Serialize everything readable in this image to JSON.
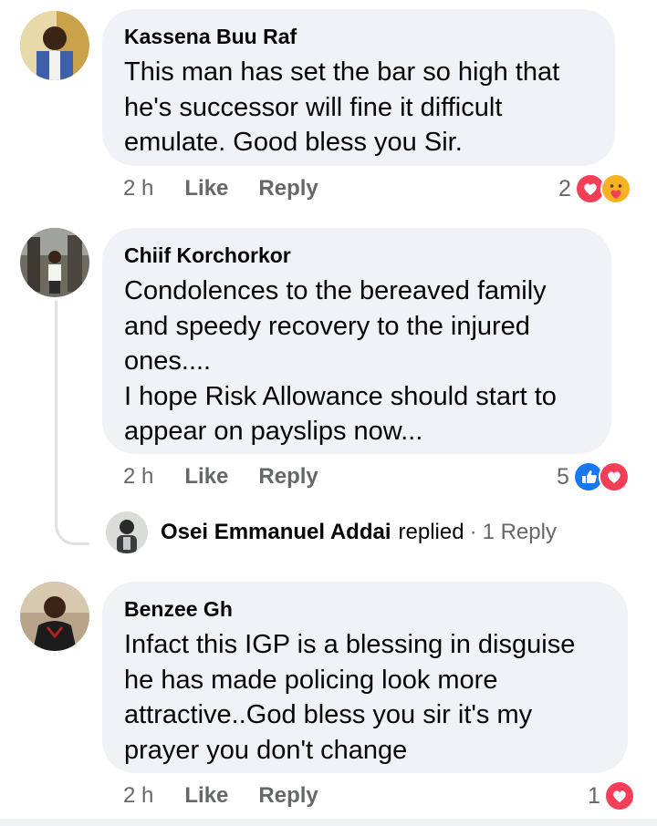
{
  "comments": [
    {
      "author": "Kassena Buu Raf",
      "text": "This man has set the bar so high that\nhe's successor will fine it difficult\nemulate. Good bless you Sir.",
      "time": "2 h",
      "like_label": "Like",
      "reply_label": "Reply",
      "reaction_count": "2",
      "reactions": [
        "love",
        "care"
      ]
    },
    {
      "author": "Chiif Korchorkor",
      "text": "Condolences to the bereaved family\nand speedy recovery to the injured\nones....\nI hope Risk Allowance should start to\nappear on payslips now...",
      "time": "2 h",
      "like_label": "Like",
      "reply_label": "Reply",
      "reaction_count": "5",
      "reactions": [
        "like",
        "love"
      ],
      "reply_thread": {
        "name": "Osei Emmanuel Addai",
        "verb": "replied",
        "separator": "·",
        "count_label": "1 Reply"
      }
    },
    {
      "author": "Benzee Gh",
      "text": "Infact this IGP is a blessing in disguise\nhe has made policing look more\nattractive..God bless you sir it's my\nprayer you don't change",
      "time": "2 h",
      "like_label": "Like",
      "reply_label": "Reply",
      "reaction_count": "1",
      "reactions": [
        "love"
      ]
    }
  ],
  "colors": {
    "bubble_bg": "#f0f2f5",
    "meta_text": "#65676b",
    "like_blue": "#1877f2",
    "love_red": "#f33e58",
    "care_yellow": "#f7b125"
  }
}
